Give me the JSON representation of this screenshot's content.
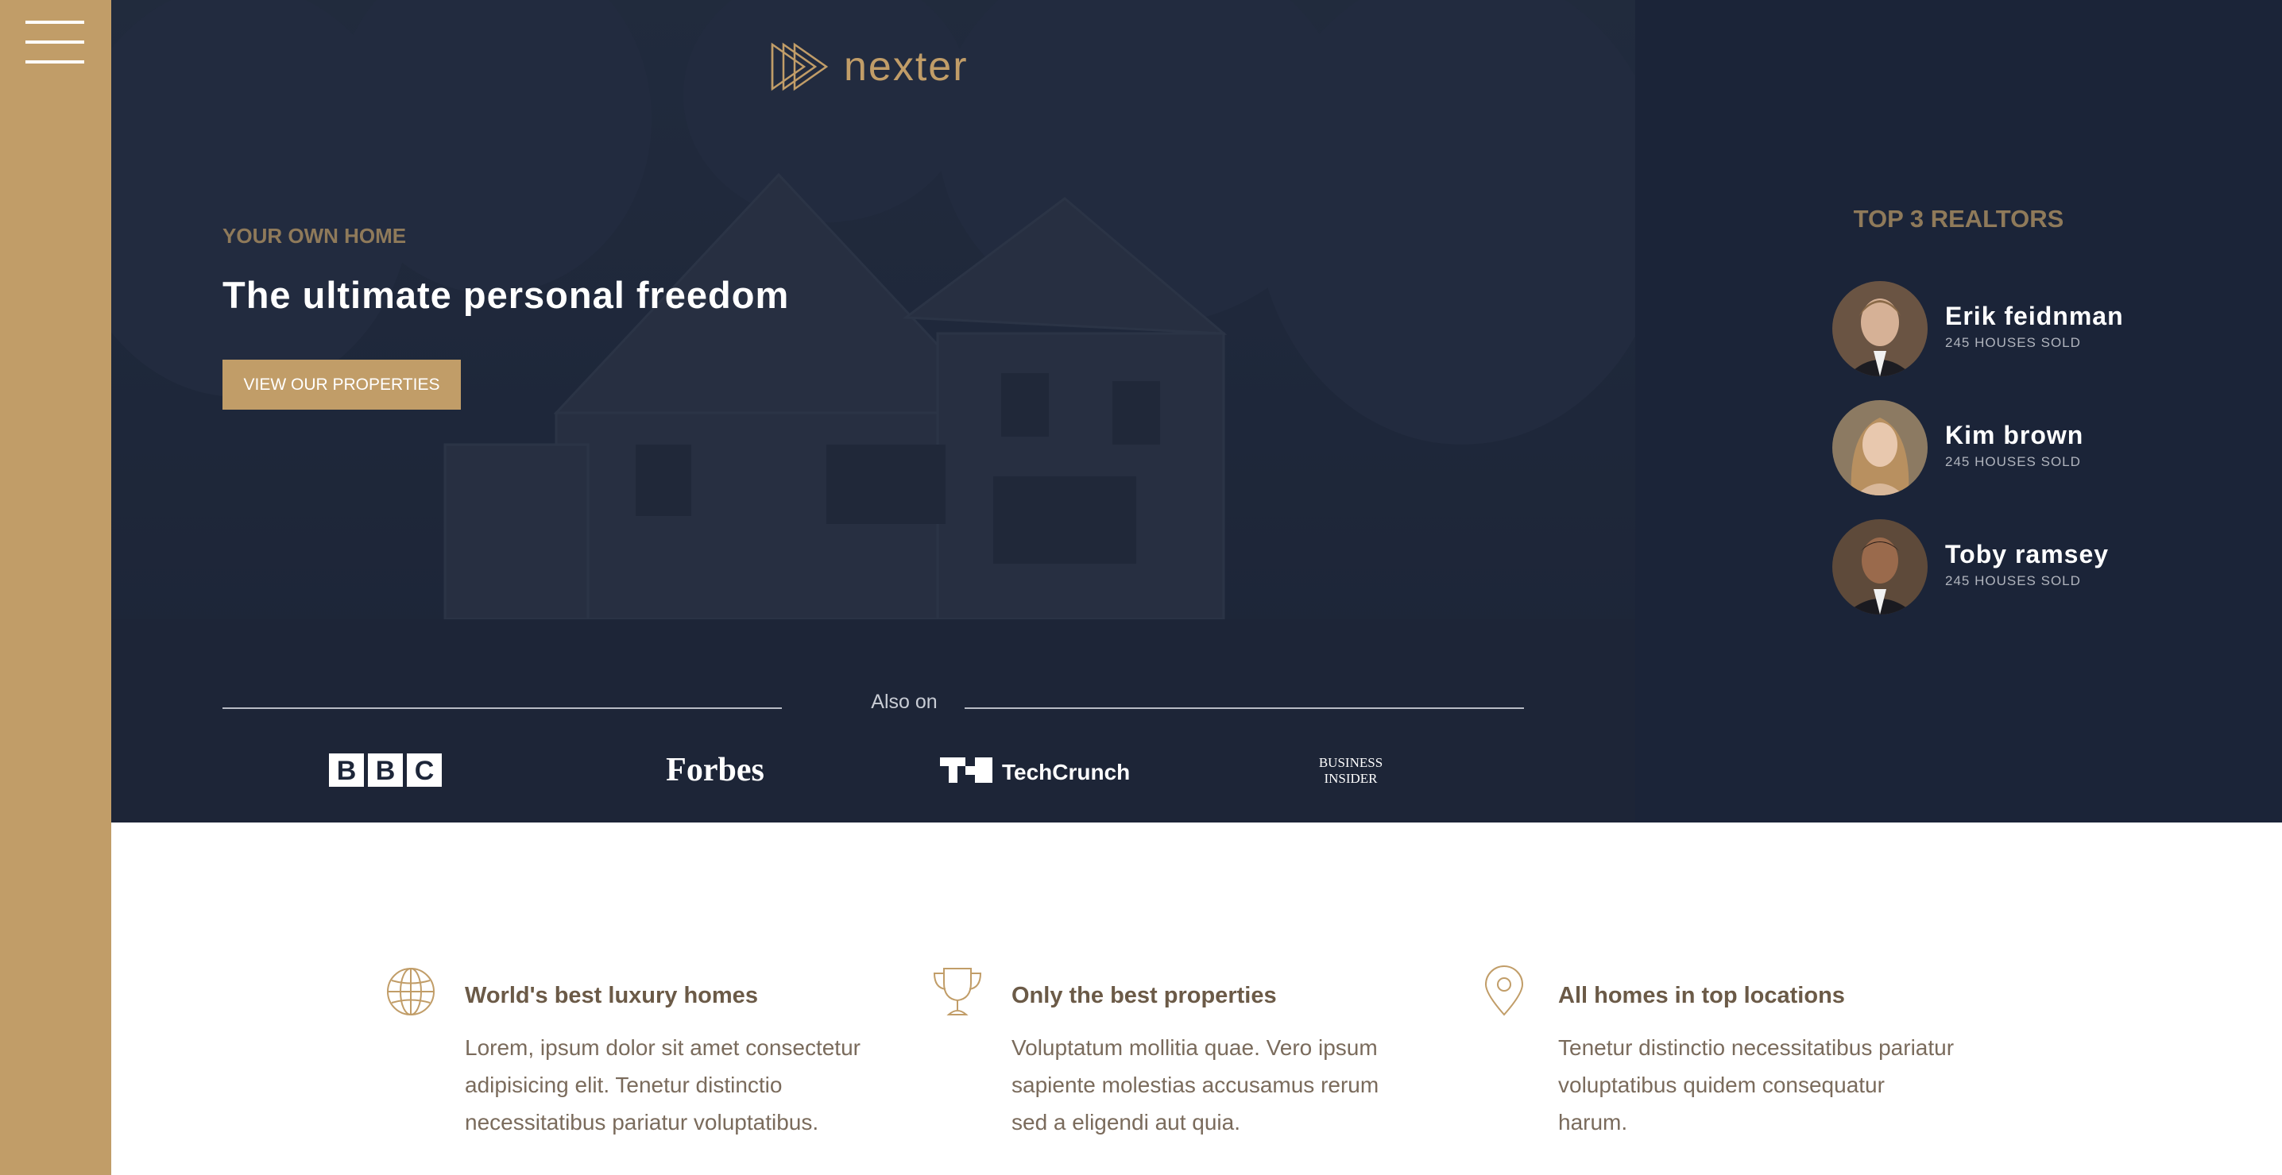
{
  "colors": {
    "accent": "#c19d68",
    "dark": "#1d2639",
    "panel": "#1b2438",
    "text_brown": "#6b5a47"
  },
  "sidebar": {
    "menu_icon": "hamburger-icon"
  },
  "header": {
    "logo_text": "nexter",
    "eyebrow": "YOUR OWN HOME",
    "headline": "The ultimate personal freedom",
    "cta_label": "VIEW OUR PROPERTIES",
    "also_on": "Also on",
    "press": [
      {
        "name": "BBC",
        "icon": "bbc-logo"
      },
      {
        "name": "Forbes",
        "icon": "forbes-logo"
      },
      {
        "name": "TechCrunch",
        "icon": "techcrunch-logo"
      },
      {
        "name": "Business Insider",
        "icon": "business-insider-logo"
      }
    ]
  },
  "realtors": {
    "title": "TOP 3 REALTORS",
    "items": [
      {
        "name": "Erik feidnman",
        "sold": "245 HOUSES SOLD"
      },
      {
        "name": "Kim brown",
        "sold": "245 HOUSES SOLD"
      },
      {
        "name": "Toby ramsey",
        "sold": "245 HOUSES SOLD"
      }
    ]
  },
  "features": [
    {
      "icon": "globe-icon",
      "title": "World's best luxury homes",
      "text": "Lorem, ipsum dolor sit amet consectetur adipisicing elit. Tenetur distinctio necessitatibus pariatur voluptatibus."
    },
    {
      "icon": "trophy-icon",
      "title": "Only the best properties",
      "text": "Voluptatum mollitia quae. Vero ipsum sapiente molestias accusamus rerum sed a eligendi aut quia."
    },
    {
      "icon": "map-pin-icon",
      "title": "All homes in top locations",
      "text": "Tenetur distinctio necessitatibus pariatur voluptatibus quidem consequatur harum."
    }
  ]
}
